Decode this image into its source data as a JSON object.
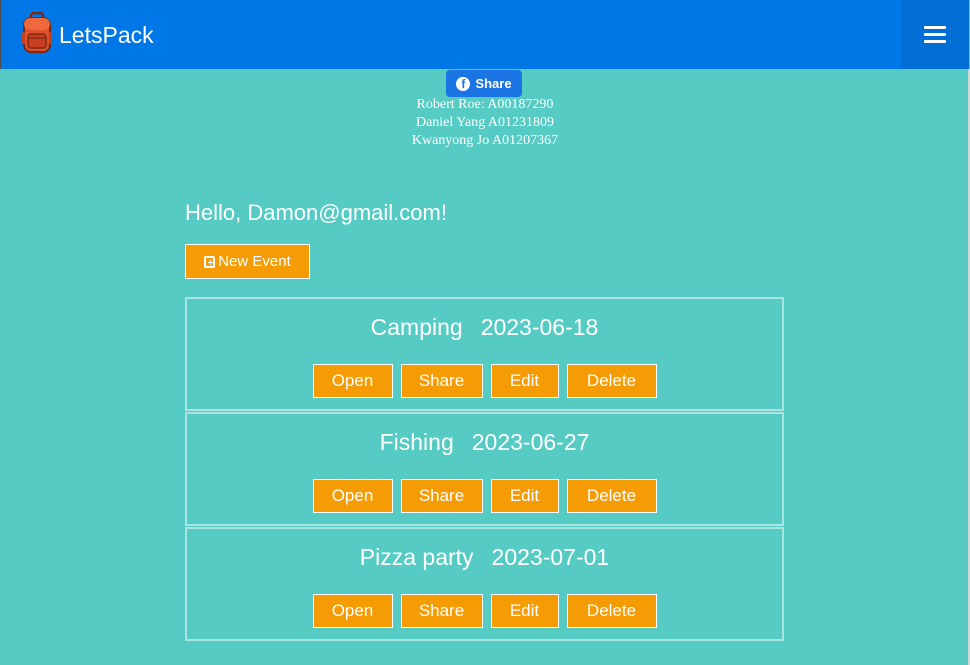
{
  "header": {
    "brand": "LetsPack",
    "brand_icon": "backpack-icon",
    "menu_icon": "hamburger-menu-icon"
  },
  "facebook_share": {
    "label": "Share",
    "icon": "facebook-icon"
  },
  "credits": [
    "Robert Roe: A00187290",
    "Daniel Yang A01231809",
    "Kwanyong Jo A01207367"
  ],
  "greeting": "Hello, Damon@gmail.com!",
  "new_event": {
    "label": "New Event",
    "icon": "calendar-plus-icon"
  },
  "events": [
    {
      "name": "Camping",
      "date": "2023-06-18"
    },
    {
      "name": "Fishing",
      "date": "2023-06-27"
    },
    {
      "name": "Pizza party",
      "date": "2023-07-01"
    }
  ],
  "event_actions": {
    "open": "Open",
    "share": "Share",
    "edit": "Edit",
    "delete": "Delete"
  },
  "colors": {
    "background": "#56cbc4",
    "navbar": "#0077e6",
    "button": "#f59c05",
    "facebook": "#1b74e4"
  }
}
